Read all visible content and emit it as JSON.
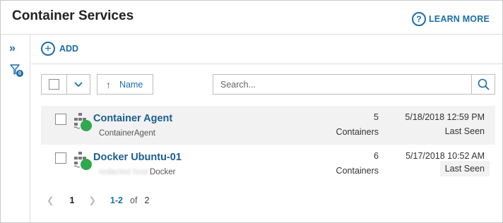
{
  "header": {
    "title": "Container Services",
    "learn_more": "LEARN MORE"
  },
  "sidebar": {
    "expand_glyph": "»",
    "filter_badge": "0"
  },
  "toolbar": {
    "add_label": "ADD"
  },
  "controls": {
    "sort_label": "Name",
    "search_placeholder": "Search..."
  },
  "rows": [
    {
      "name": "Container Agent",
      "subtitle": "ContainerAgent",
      "count": "5",
      "count_label": "Containers",
      "date": "5/18/2018 12:59 PM",
      "seen_label": "Last Seen",
      "status_color": "#2fa84f"
    },
    {
      "name": "Docker Ubuntu-01",
      "subtitle_blurred": "redacted host",
      "subtitle": "Docker",
      "count": "6",
      "count_label": "Containers",
      "date": "5/17/2018 10:52 AM",
      "seen_label": "Last Seen",
      "status_color": "#2fa84f"
    }
  ],
  "pager": {
    "current_page": "1",
    "range": "1-2",
    "of": "of",
    "total": "2"
  },
  "colors": {
    "accent": "#1b6ea8",
    "link": "#1b5e8e",
    "status_up": "#2fa84f"
  }
}
